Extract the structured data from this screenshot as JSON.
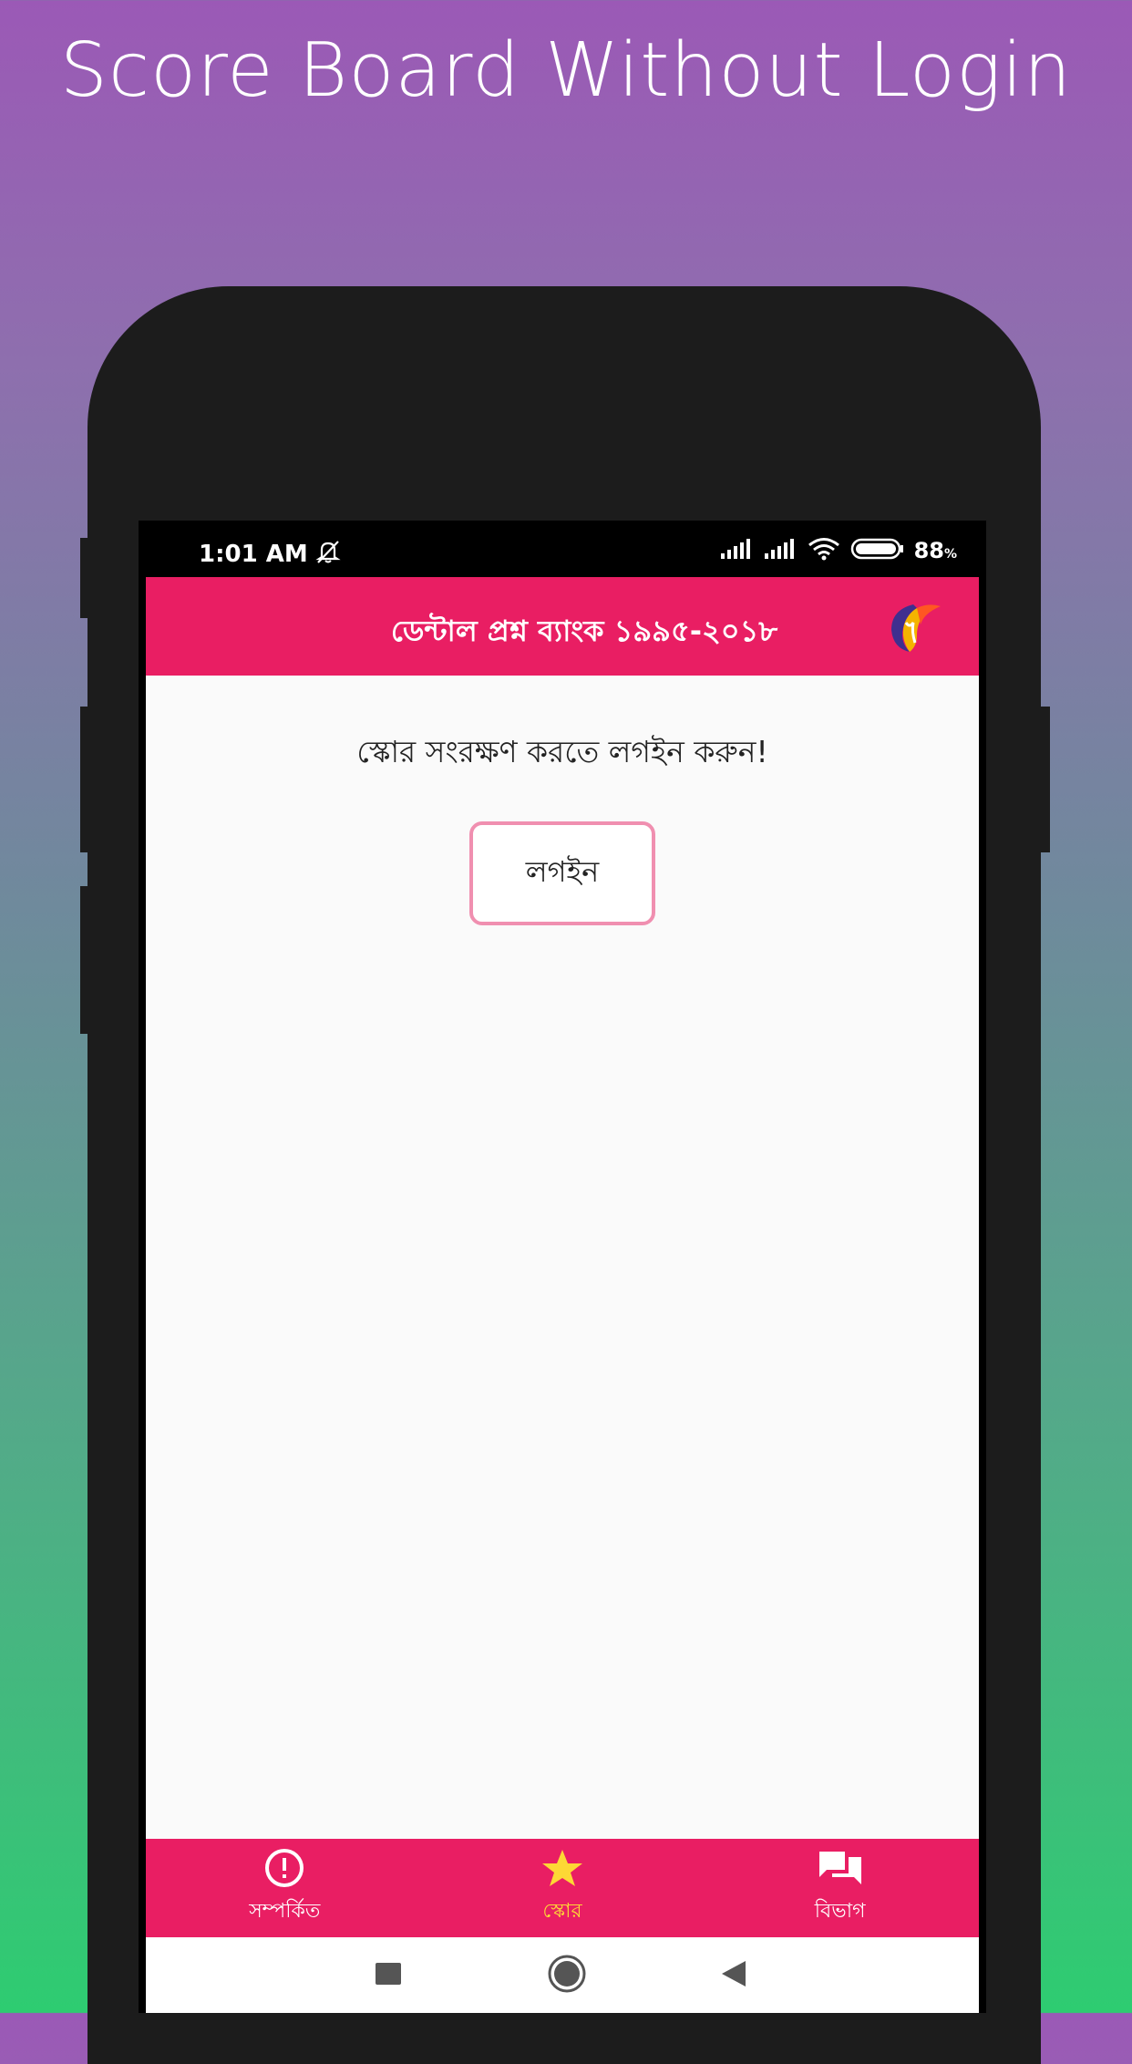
{
  "promo": {
    "title": "Score Board Without Login"
  },
  "status_bar": {
    "time": "1:01 AM",
    "battery_percent": "88",
    "battery_unit": "%"
  },
  "app_bar": {
    "title": "ডেন্টাল প্রশ্ন ব্যাংক ১৯৯৫-২০১৮"
  },
  "content": {
    "prompt": "স্কোর সংরক্ষণ করতে লগইন করুন!",
    "login_label": "লগইন"
  },
  "bottom_nav": {
    "items": [
      {
        "label": "সম্পর্কিত",
        "icon": "info-circle-icon"
      },
      {
        "label": "স্কোর",
        "icon": "star-icon",
        "active": true
      },
      {
        "label": "বিভাগ",
        "icon": "chat-bubbles-icon"
      }
    ]
  },
  "colors": {
    "accent": "#e91e63",
    "active_nav": "#fdd835",
    "login_border": "#f08fb0"
  }
}
